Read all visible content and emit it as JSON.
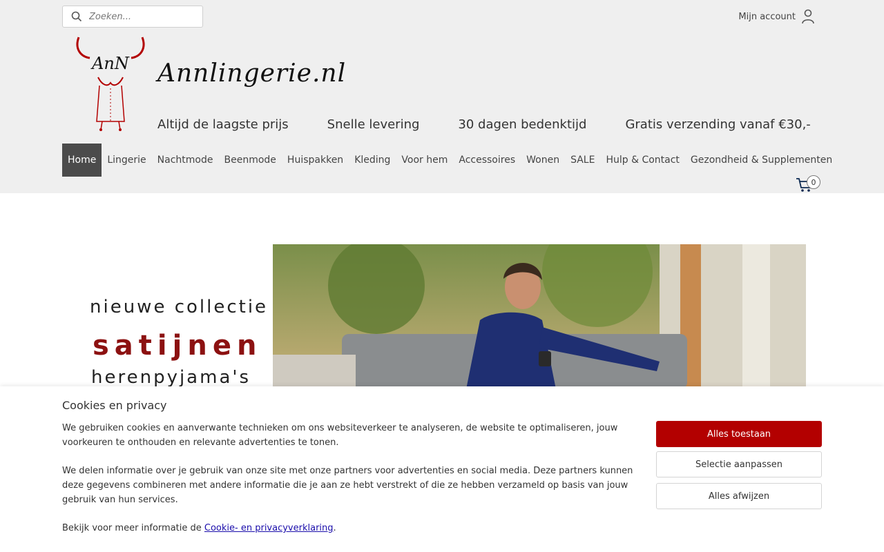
{
  "search": {
    "placeholder": "Zoeken..."
  },
  "account": {
    "label": "Mijn account"
  },
  "brand": {
    "name": "Annlingerie.nl",
    "logo_text": "AnN"
  },
  "usps": [
    "Altijd de laagste prijs",
    "Snelle levering",
    "30 dagen bedenktijd",
    "Gratis verzending vanaf €30,-"
  ],
  "nav": {
    "items": [
      "Home",
      "Lingerie",
      "Nachtmode",
      "Beenmode",
      "Huispakken",
      "Kleding",
      "Voor hem",
      "Accessoires",
      "Wonen",
      "SALE",
      "Hulp & Contact",
      "Gezondheid & Supplementen"
    ],
    "active": "Home"
  },
  "cart": {
    "count": "0"
  },
  "banner": {
    "line1": "nieuwe collectie",
    "line2": "satijnen",
    "line3": "herenpyjama's"
  },
  "cookie": {
    "title": "Cookies en privacy",
    "p1": "We gebruiken cookies en aanverwante technieken om ons websiteverkeer te analyseren, de website te optimaliseren, jouw voorkeuren te onthouden en relevante advertenties te tonen.",
    "p2": "We delen informatie over je gebruik van onze site met onze partners voor advertenties en social media. Deze partners kunnen deze gegevens combineren met andere informatie die je aan ze hebt verstrekt of die ze hebben verzameld op basis van jouw gebruik van hun services.",
    "p3_prefix": "Bekijk voor meer informatie de ",
    "p3_link": "Cookie- en privacyverklaring",
    "p3_suffix": ".",
    "accept": "Alles toestaan",
    "customize": "Selectie aanpassen",
    "reject": "Alles afwijzen"
  },
  "colors": {
    "accent": "#b30000",
    "header_bg": "#efefef",
    "nav_active": "#4b4b4b",
    "banner_red": "#8c1111"
  }
}
